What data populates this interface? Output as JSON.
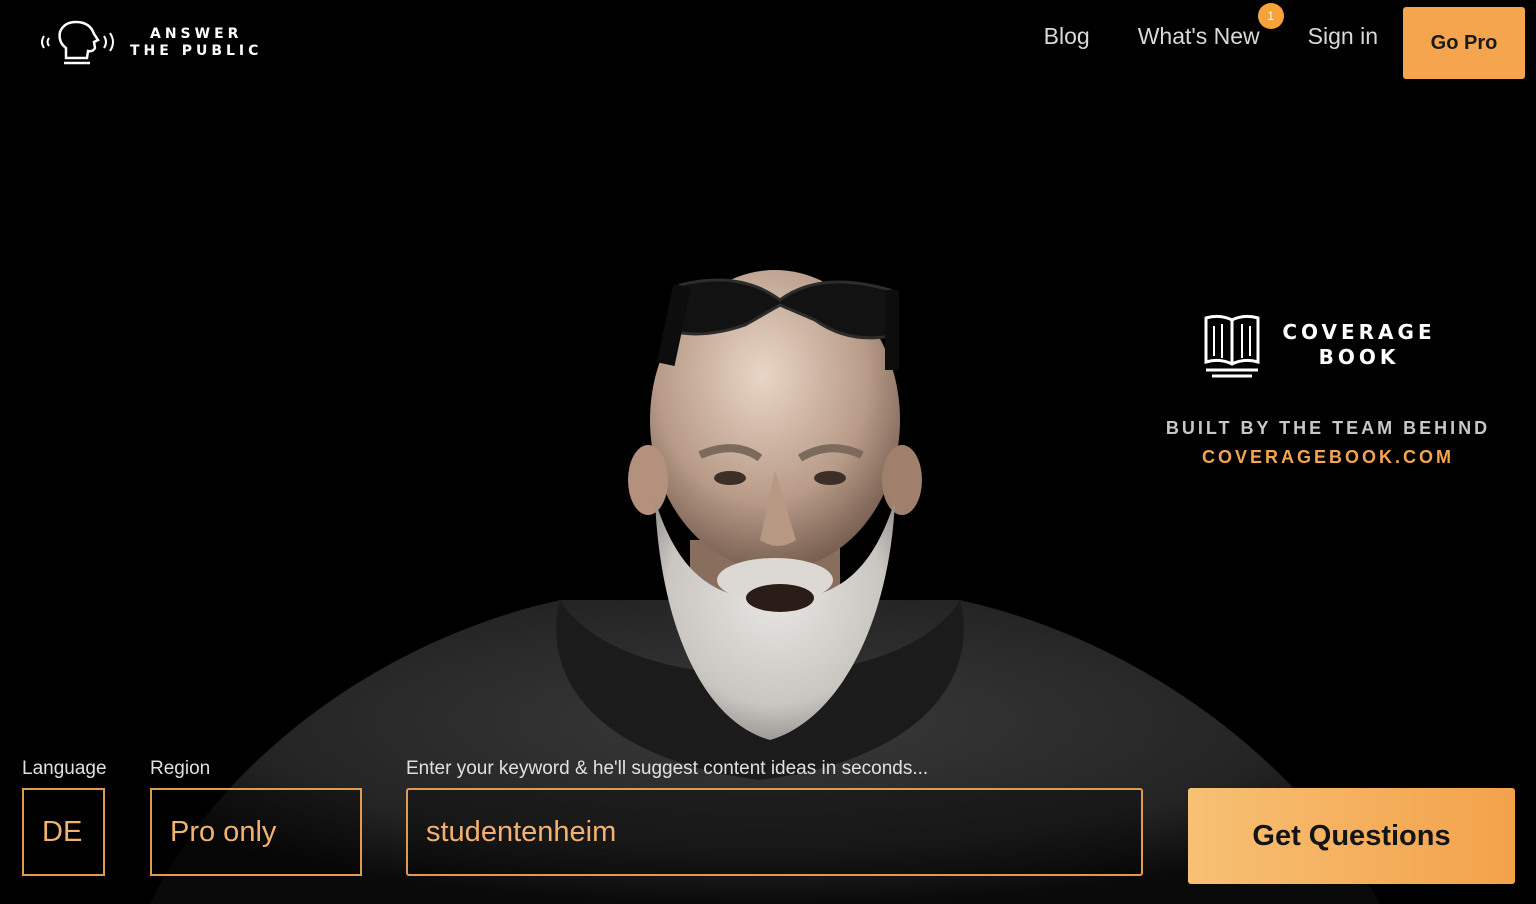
{
  "brand": {
    "logo_line1": "ANSWER",
    "logo_line2": "THE PUBLIC"
  },
  "nav": {
    "blog": "Blog",
    "whats_new": "What's New",
    "whats_new_badge": "1",
    "sign_in": "Sign in",
    "go_pro": "Go Pro"
  },
  "sponsor": {
    "name_line1": "COVERAGE",
    "name_line2": "BOOK",
    "built_by": "BUILT BY THE TEAM BEHIND",
    "url": "COVERAGEBOOK.COM"
  },
  "search": {
    "language_label": "Language",
    "language_value": "DE",
    "region_label": "Region",
    "region_value": "Pro only",
    "keyword_label": "Enter your keyword & he'll suggest content ideas in seconds...",
    "keyword_value": "studentenheim",
    "submit": "Get Questions"
  },
  "colors": {
    "accent": "#f5a54d",
    "background": "#000000",
    "badge": "#f7a23a"
  },
  "icons": [
    "speaking-head-icon",
    "open-book-icon"
  ]
}
